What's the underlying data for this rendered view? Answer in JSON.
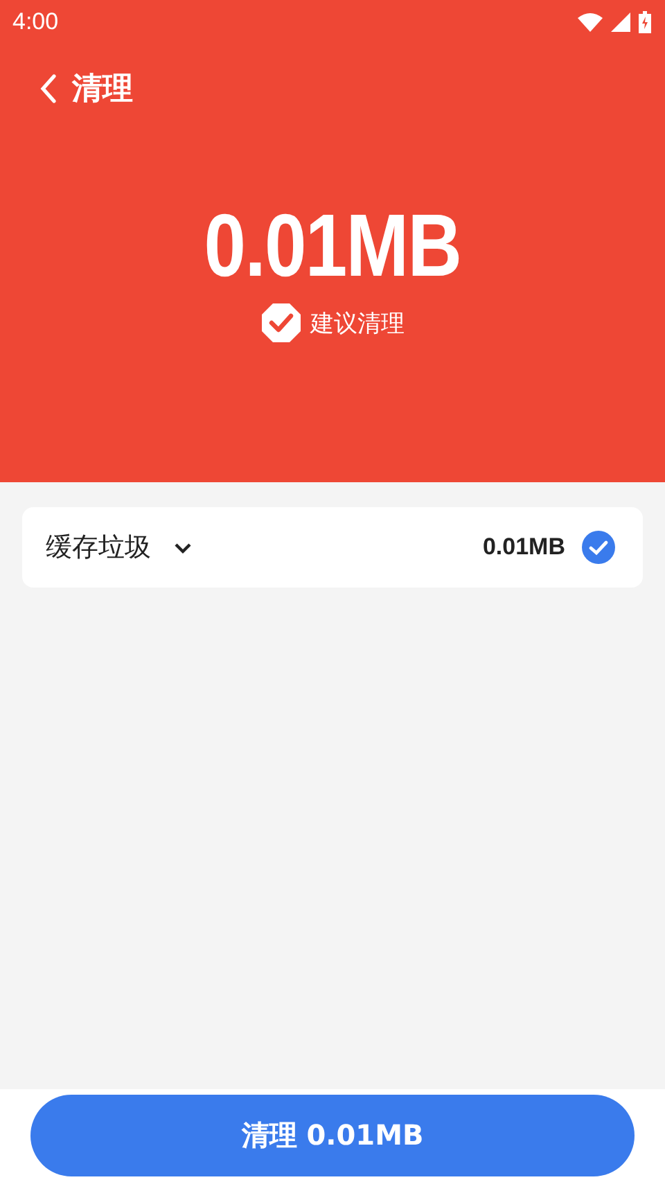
{
  "status_bar": {
    "time": "4:00"
  },
  "header": {
    "title": "清理",
    "size": "0.01MB",
    "recommendation": "建议清理"
  },
  "categories": [
    {
      "name": "缓存垃圾",
      "size": "0.01MB",
      "expanded": false,
      "checked": true
    }
  ],
  "action_button": {
    "label": "清理 0.01MB"
  }
}
